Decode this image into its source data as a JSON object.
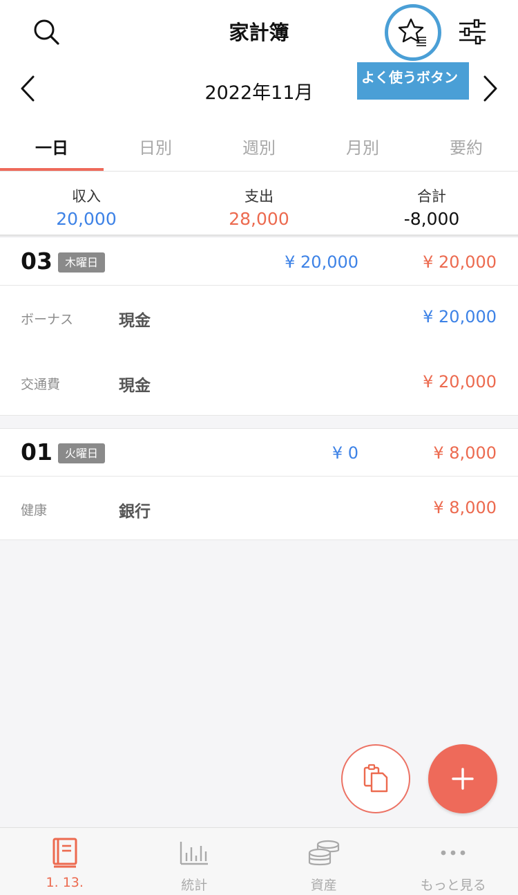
{
  "header": {
    "title": "家計簿",
    "tooltip": "よく使うボタン",
    "month": "2022年11月"
  },
  "tabs": [
    {
      "label": "一日",
      "active": true
    },
    {
      "label": "日別",
      "active": false
    },
    {
      "label": "週別",
      "active": false
    },
    {
      "label": "月別",
      "active": false
    },
    {
      "label": "要約",
      "active": false
    }
  ],
  "summary": {
    "income_label": "収入",
    "income_value": "20,000",
    "expense_label": "支出",
    "expense_value": "28,000",
    "total_label": "合計",
    "total_value": "-8,000"
  },
  "days": [
    {
      "day": "03",
      "weekday": "木曜日",
      "income": "¥ 20,000",
      "expense": "¥ 20,000",
      "transactions": [
        {
          "category": "ボーナス",
          "account": "現金",
          "amount": "¥ 20,000",
          "type": "income"
        },
        {
          "category": "交通費",
          "account": "現金",
          "amount": "¥ 20,000",
          "type": "expense"
        }
      ]
    },
    {
      "day": "01",
      "weekday": "火曜日",
      "income": "¥ 0",
      "expense": "¥ 8,000",
      "transactions": [
        {
          "category": "健康",
          "account": "銀行",
          "amount": "¥ 8,000",
          "type": "expense"
        }
      ]
    }
  ],
  "tabbar": [
    {
      "label": "1. 13.",
      "icon": "book-icon",
      "active": true
    },
    {
      "label": "統計",
      "icon": "bar-chart-icon",
      "active": false
    },
    {
      "label": "資産",
      "icon": "coins-icon",
      "active": false
    },
    {
      "label": "もっと見る",
      "icon": "more-icon",
      "active": false
    }
  ],
  "colors": {
    "accent": "#ee6a5a",
    "income": "#3d82e6",
    "expense": "#ec6a4f",
    "highlight": "#4a9fd6"
  }
}
